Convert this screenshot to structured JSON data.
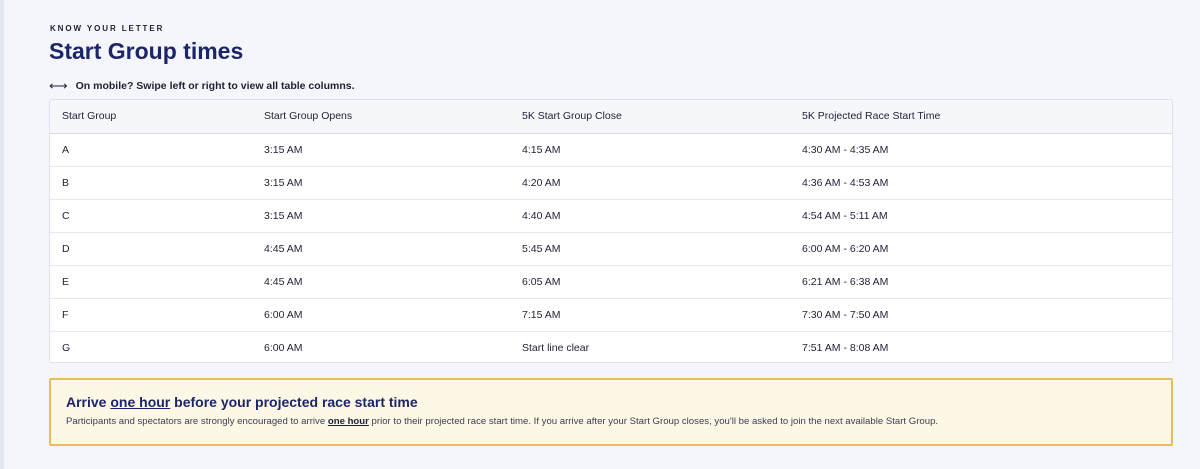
{
  "section": {
    "eyebrow": "KNOW YOUR LETTER",
    "title": "Start Group times",
    "swipe_icon": "left-right-arrow-icon",
    "swipe_arrows": "⟷",
    "swipe_note": "On mobile? Swipe left or right to view all table columns."
  },
  "table": {
    "headers": [
      "Start Group",
      "Start Group Opens",
      "5K Start Group Close",
      "5K Projected Race Start Time"
    ],
    "rows": [
      [
        "A",
        "3:15 AM",
        "4:15 AM",
        "4:30 AM - 4:35 AM"
      ],
      [
        "B",
        "3:15 AM",
        "4:20 AM",
        "4:36 AM - 4:53 AM"
      ],
      [
        "C",
        "3:15 AM",
        "4:40 AM",
        "4:54 AM - 5:11 AM"
      ],
      [
        "D",
        "4:45 AM",
        "5:45 AM",
        "6:00 AM - 6:20 AM"
      ],
      [
        "E",
        "4:45 AM",
        "6:05 AM",
        "6:21 AM - 6:38 AM"
      ],
      [
        "F",
        "6:00 AM",
        "7:15 AM",
        "7:30 AM - 7:50 AM"
      ],
      [
        "G",
        "6:00 AM",
        "Start line clear",
        "7:51 AM - 8:08 AM"
      ]
    ]
  },
  "notice": {
    "title_pre": "Arrive ",
    "title_emph": "one hour",
    "title_post": " before your projected race start time",
    "body_pre": "Participants and spectators are strongly encouraged to arrive ",
    "body_emph": "one hour",
    "body_post": " prior to their projected race start time. If you arrive after your Start Group closes, you'll be asked to join the next available Start Group."
  },
  "colors": {
    "page_bg": "#f4f6fb",
    "title": "#1c2569",
    "notice_bg": "#fdf7e5",
    "notice_border": "#e8bf55"
  }
}
